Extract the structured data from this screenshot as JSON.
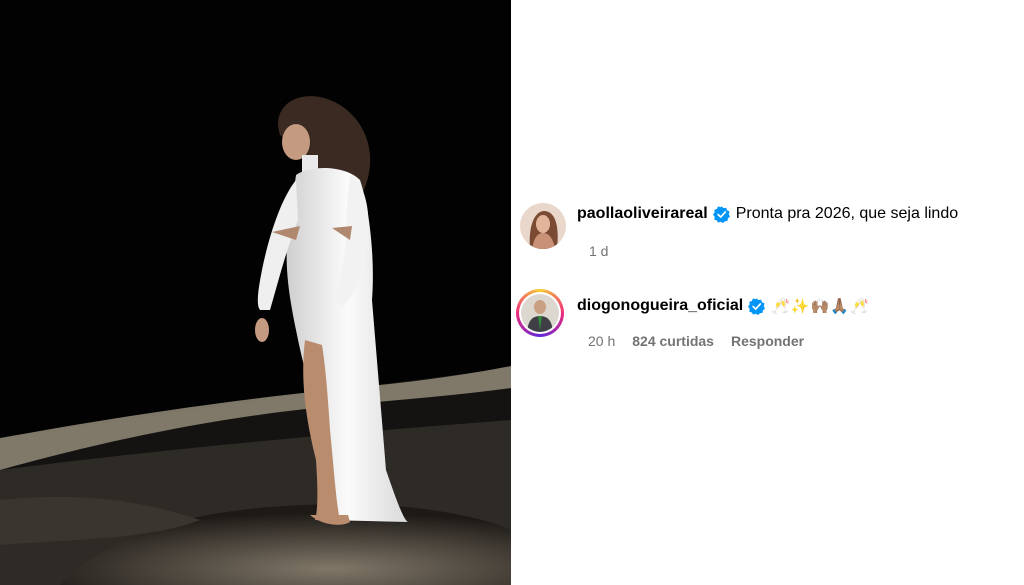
{
  "post": {
    "photo_alt": "photo"
  },
  "comments": [
    {
      "username": "paollaoliveirareal",
      "verified": true,
      "text": "Pronta pra 2026, que seja lindo",
      "time": "1 d"
    },
    {
      "username": "diogonogueira_oficial",
      "verified": true,
      "text": "🥂✨🙌🏽🙏🏽🥂",
      "time": "20 h",
      "likes": "824 curtidas",
      "reply_label": "Responder"
    }
  ],
  "colors": {
    "verified": "#0095f6",
    "meta_text": "#737373",
    "photo_bg": "#020202"
  }
}
